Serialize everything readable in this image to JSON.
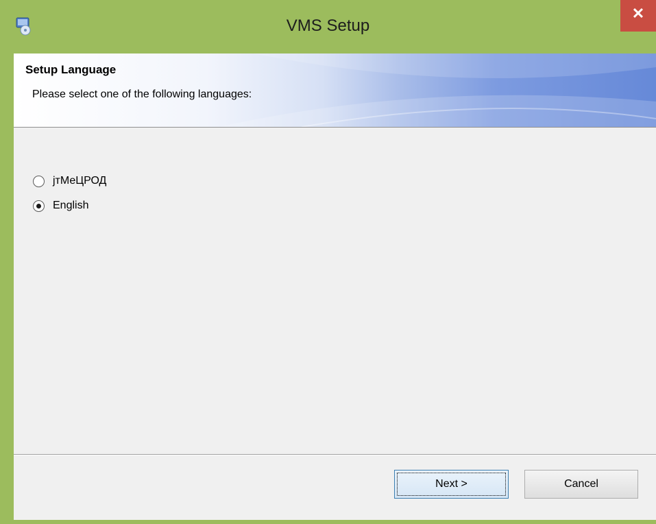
{
  "window": {
    "title": "VMS Setup",
    "app_icon": "setup-installer-icon",
    "close_icon": "close-icon",
    "close_glyph": "✕",
    "colors": {
      "frame": "#9cbc5d",
      "close_button": "#c94d42",
      "banner_accent": "#6689d8",
      "client_background": "#f0f0f0"
    }
  },
  "banner": {
    "title": "Setup Language",
    "subtitle": "Please select one of the following languages:"
  },
  "languages": {
    "options": [
      {
        "label": "јтМеЦРОД",
        "selected": false
      },
      {
        "label": "English",
        "selected": true
      }
    ]
  },
  "buttons": {
    "next_label": "Next >",
    "cancel_label": "Cancel"
  }
}
